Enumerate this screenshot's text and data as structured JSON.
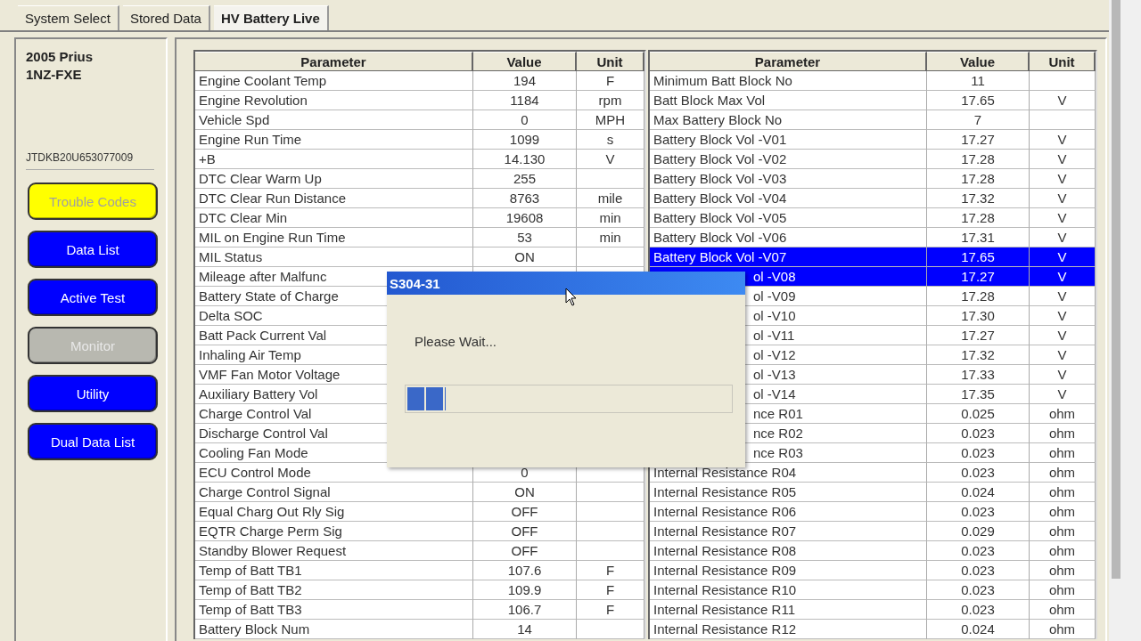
{
  "tabs": [
    {
      "label": "System Select",
      "selected": false
    },
    {
      "label": "Stored Data",
      "selected": false
    },
    {
      "label": "HV Battery Live",
      "selected": true
    }
  ],
  "sidebar": {
    "vehicle": [
      "2005 Prius",
      "1NZ-FXE"
    ],
    "vin": "JTDKB20U653077009",
    "buttons": [
      {
        "label": "Trouble Codes",
        "kind": "current"
      },
      {
        "label": "Data List",
        "kind": "action"
      },
      {
        "label": "Active Test",
        "kind": "action"
      },
      {
        "label": "Monitor",
        "kind": "unavailable"
      },
      {
        "label": "Utility",
        "kind": "action"
      },
      {
        "label": "Dual Data List",
        "kind": "action"
      }
    ]
  },
  "tables": [
    {
      "columns": [
        "Parameter",
        "Value",
        "Unit"
      ],
      "rows": [
        {
          "parameter": "Engine Coolant Temp",
          "value": "194",
          "unit": "F",
          "selected": false
        },
        {
          "parameter": "Engine Revolution",
          "value": "1184",
          "unit": "rpm",
          "selected": false
        },
        {
          "parameter": "Vehicle Spd",
          "value": "0",
          "unit": "MPH",
          "selected": false
        },
        {
          "parameter": "Engine Run Time",
          "value": "1099",
          "unit": "s",
          "selected": false
        },
        {
          "parameter": "+B",
          "value": "14.130",
          "unit": "V",
          "selected": false
        },
        {
          "parameter": "DTC Clear Warm Up",
          "value": "255",
          "selected": false
        },
        {
          "parameter": "DTC Clear Run Distance",
          "value": "8763",
          "unit": "mile",
          "selected": false
        },
        {
          "parameter": "DTC Clear Min",
          "value": "19608",
          "unit": "min",
          "selected": false
        },
        {
          "parameter": "MIL on Engine Run Time",
          "value": "53",
          "unit": "min",
          "selected": false
        },
        {
          "parameter": "MIL Status",
          "value": "ON",
          "selected": false
        },
        {
          "parameter": "Mileage after Malfunc",
          "selected": false
        },
        {
          "parameter": "Battery State of Charge",
          "selected": false
        },
        {
          "parameter": "Delta SOC",
          "selected": false
        },
        {
          "parameter": "Batt Pack Current Val",
          "selected": false
        },
        {
          "parameter": "Inhaling Air Temp",
          "selected": false
        },
        {
          "parameter": "VMF Fan Motor Voltage",
          "selected": false
        },
        {
          "parameter": "Auxiliary Battery Vol",
          "selected": false
        },
        {
          "parameter": "Charge Control Val",
          "selected": false
        },
        {
          "parameter": "Discharge Control Val",
          "selected": false
        },
        {
          "parameter": "Cooling Fan Mode",
          "selected": false
        },
        {
          "parameter": "ECU Control Mode",
          "value": "0",
          "selected": false
        },
        {
          "parameter": "Charge Control Signal",
          "value": "ON",
          "selected": false
        },
        {
          "parameter": "Equal Charg Out Rly Sig",
          "value": "OFF",
          "selected": false
        },
        {
          "parameter": "EQTR Charge Perm Sig",
          "value": "OFF",
          "selected": false
        },
        {
          "parameter": "Standby Blower Request",
          "value": "OFF",
          "selected": false
        },
        {
          "parameter": "Temp of Batt TB1",
          "value": "107.6",
          "unit": "F",
          "selected": false
        },
        {
          "parameter": "Temp of Batt TB2",
          "value": "109.9",
          "unit": "F",
          "selected": false
        },
        {
          "parameter": "Temp of Batt TB3",
          "value": "106.7",
          "unit": "F",
          "selected": false
        },
        {
          "parameter": "Battery Block Num",
          "value": "14",
          "selected": false
        }
      ]
    },
    {
      "columns": [
        "Parameter",
        "Value",
        "Unit"
      ],
      "rows": [
        {
          "parameter": "Minimum Batt Block No",
          "value": "11",
          "selected": false
        },
        {
          "parameter": "Batt Block Max Vol",
          "value": "17.65",
          "unit": "V",
          "selected": false
        },
        {
          "parameter": "Max Battery Block No",
          "value": "7",
          "selected": false
        },
        {
          "parameter": "Battery Block Vol -V01",
          "value": "17.27",
          "unit": "V",
          "selected": false
        },
        {
          "parameter": "Battery Block Vol -V02",
          "value": "17.28",
          "unit": "V",
          "selected": false
        },
        {
          "parameter": "Battery Block Vol -V03",
          "value": "17.28",
          "unit": "V",
          "selected": false
        },
        {
          "parameter": "Battery Block Vol -V04",
          "value": "17.32",
          "unit": "V",
          "selected": false
        },
        {
          "parameter": "Battery Block Vol -V05",
          "value": "17.28",
          "unit": "V",
          "selected": false
        },
        {
          "parameter": "Battery Block Vol -V06",
          "value": "17.31",
          "unit": "V",
          "selected": false
        },
        {
          "parameter": "Battery Block Vol -V07",
          "value": "17.65",
          "unit": "V",
          "selected": true
        },
        {
          "parameter": "ol -V08",
          "covered": true,
          "value": "17.27",
          "unit": "V",
          "selected": true
        },
        {
          "parameter": "ol -V09",
          "covered": true,
          "value": "17.28",
          "unit": "V",
          "selected": false
        },
        {
          "parameter": "ol -V10",
          "covered": true,
          "value": "17.30",
          "unit": "V",
          "selected": false
        },
        {
          "parameter": "ol -V11",
          "covered": true,
          "value": "17.27",
          "unit": "V",
          "selected": false
        },
        {
          "parameter": "ol -V12",
          "covered": true,
          "value": "17.32",
          "unit": "V",
          "selected": false
        },
        {
          "parameter": "ol -V13",
          "covered": true,
          "value": "17.33",
          "unit": "V",
          "selected": false
        },
        {
          "parameter": "ol -V14",
          "covered": true,
          "value": "17.35",
          "unit": "V",
          "selected": false
        },
        {
          "parameter": "nce R01",
          "covered": true,
          "value": "0.025",
          "unit": "ohm",
          "selected": false
        },
        {
          "parameter": "nce R02",
          "covered": true,
          "value": "0.023",
          "unit": "ohm",
          "selected": false
        },
        {
          "parameter": "nce R03",
          "covered": true,
          "value": "0.023",
          "unit": "ohm",
          "selected": false
        },
        {
          "parameter": "Internal Resistance R04",
          "value": "0.023",
          "unit": "ohm",
          "selected": false
        },
        {
          "parameter": "Internal Resistance R05",
          "value": "0.024",
          "unit": "ohm",
          "selected": false
        },
        {
          "parameter": "Internal Resistance R06",
          "value": "0.023",
          "unit": "ohm",
          "selected": false
        },
        {
          "parameter": "Internal Resistance R07",
          "value": "0.029",
          "unit": "ohm",
          "selected": false
        },
        {
          "parameter": "Internal Resistance R08",
          "value": "0.023",
          "unit": "ohm",
          "selected": false
        },
        {
          "parameter": "Internal Resistance R09",
          "value": "0.023",
          "unit": "ohm",
          "selected": false
        },
        {
          "parameter": "Internal Resistance R10",
          "value": "0.023",
          "unit": "ohm",
          "selected": false
        },
        {
          "parameter": "Internal Resistance R11",
          "value": "0.023",
          "unit": "ohm",
          "selected": false
        },
        {
          "parameter": "Internal Resistance R12",
          "value": "0.024",
          "unit": "ohm",
          "selected": false
        }
      ]
    }
  ],
  "dialog": {
    "title": "S304-31",
    "message": "Please Wait...",
    "progress": {
      "level": 0.12
    }
  }
}
